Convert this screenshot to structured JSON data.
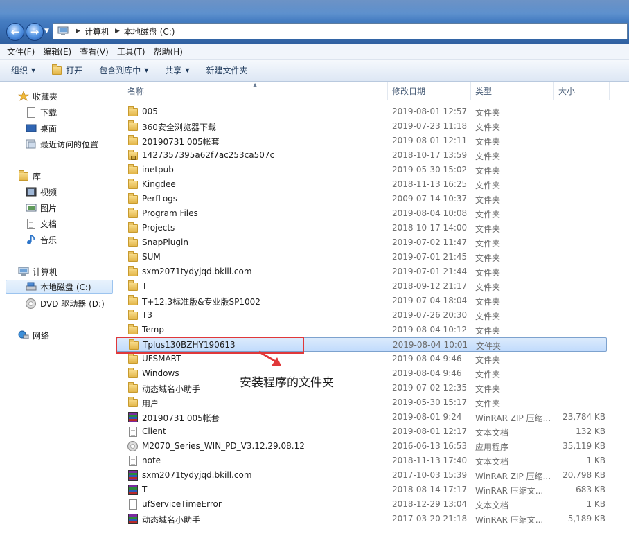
{
  "address": {
    "crumbs": [
      "计算机",
      "本地磁盘 (C:)"
    ]
  },
  "menu": [
    "文件(F)",
    "编辑(E)",
    "查看(V)",
    "工具(T)",
    "帮助(H)"
  ],
  "toolbar": {
    "organize": "组织",
    "open": "打开",
    "include": "包含到库中",
    "share": "共享",
    "new_folder": "新建文件夹"
  },
  "nav": {
    "favorites": "收藏夹",
    "downloads": "下载",
    "desktop": "桌面",
    "recent": "最近访问的位置",
    "libraries": "库",
    "videos": "视频",
    "pictures": "图片",
    "documents": "文档",
    "music": "音乐",
    "computer": "计算机",
    "local_disk": "本地磁盘 (C:)",
    "dvd": "DVD 驱动器 (D:)",
    "network": "网络"
  },
  "columns": {
    "name": "名称",
    "date": "修改日期",
    "type": "类型",
    "size": "大小"
  },
  "files": [
    {
      "name": "005",
      "date": "2019-08-01 12:57",
      "type": "文件夹",
      "size": "",
      "icon": "folder"
    },
    {
      "name": "360安全浏览器下载",
      "date": "2019-07-23 11:18",
      "type": "文件夹",
      "size": "",
      "icon": "folder"
    },
    {
      "name": "20190731 005帐套",
      "date": "2019-08-01 12:11",
      "type": "文件夹",
      "size": "",
      "icon": "folder"
    },
    {
      "name": "1427357395a62f7ac253ca507c",
      "date": "2018-10-17 13:59",
      "type": "文件夹",
      "size": "",
      "icon": "locked-folder"
    },
    {
      "name": "inetpub",
      "date": "2019-05-30 15:02",
      "type": "文件夹",
      "size": "",
      "icon": "folder"
    },
    {
      "name": "Kingdee",
      "date": "2018-11-13 16:25",
      "type": "文件夹",
      "size": "",
      "icon": "folder"
    },
    {
      "name": "PerfLogs",
      "date": "2009-07-14 10:37",
      "type": "文件夹",
      "size": "",
      "icon": "folder"
    },
    {
      "name": "Program Files",
      "date": "2019-08-04 10:08",
      "type": "文件夹",
      "size": "",
      "icon": "folder"
    },
    {
      "name": "Projects",
      "date": "2018-10-17 14:00",
      "type": "文件夹",
      "size": "",
      "icon": "folder"
    },
    {
      "name": "SnapPlugin",
      "date": "2019-07-02 11:47",
      "type": "文件夹",
      "size": "",
      "icon": "folder"
    },
    {
      "name": "SUM",
      "date": "2019-07-01 21:45",
      "type": "文件夹",
      "size": "",
      "icon": "folder"
    },
    {
      "name": "sxm2071tydyjqd.bkill.com",
      "date": "2019-07-01 21:44",
      "type": "文件夹",
      "size": "",
      "icon": "folder"
    },
    {
      "name": "T",
      "date": "2018-09-12 21:17",
      "type": "文件夹",
      "size": "",
      "icon": "folder"
    },
    {
      "name": "T+12.3标准版&专业版SP1002",
      "date": "2019-07-04 18:04",
      "type": "文件夹",
      "size": "",
      "icon": "folder"
    },
    {
      "name": "T3",
      "date": "2019-07-26 20:30",
      "type": "文件夹",
      "size": "",
      "icon": "folder"
    },
    {
      "name": "Temp",
      "date": "2019-08-04 10:12",
      "type": "文件夹",
      "size": "",
      "icon": "folder"
    },
    {
      "name": "Tplus130BZHY190613",
      "date": "2019-08-04 10:01",
      "type": "文件夹",
      "size": "",
      "icon": "folder",
      "selected": true
    },
    {
      "name": "UFSMART",
      "date": "2019-08-04 9:46",
      "type": "文件夹",
      "size": "",
      "icon": "folder"
    },
    {
      "name": "Windows",
      "date": "2019-08-04 9:46",
      "type": "文件夹",
      "size": "",
      "icon": "folder"
    },
    {
      "name": "动态域名小助手",
      "date": "2019-07-02 12:35",
      "type": "文件夹",
      "size": "",
      "icon": "folder"
    },
    {
      "name": "用户",
      "date": "2019-05-30 15:17",
      "type": "文件夹",
      "size": "",
      "icon": "folder"
    },
    {
      "name": "20190731 005帐套",
      "date": "2019-08-01 9:24",
      "type": "WinRAR ZIP 压缩...",
      "size": "23,784 KB",
      "icon": "rar"
    },
    {
      "name": "Client",
      "date": "2019-08-01 12:17",
      "type": "文本文档",
      "size": "132 KB",
      "icon": "doc"
    },
    {
      "name": "M2070_Series_WIN_PD_V3.12.29.08.12",
      "date": "2016-06-13 16:53",
      "type": "应用程序",
      "size": "35,119 KB",
      "icon": "disc"
    },
    {
      "name": "note",
      "date": "2018-11-13 17:40",
      "type": "文本文档",
      "size": "1 KB",
      "icon": "doc"
    },
    {
      "name": "sxm2071tydyjqd.bkill.com",
      "date": "2017-10-03 15:39",
      "type": "WinRAR ZIP 压缩...",
      "size": "20,798 KB",
      "icon": "rar"
    },
    {
      "name": "T",
      "date": "2018-08-14 17:17",
      "type": "WinRAR 压缩文...",
      "size": "683 KB",
      "icon": "rar"
    },
    {
      "name": "ufServiceTimeError",
      "date": "2018-12-29 13:04",
      "type": "文本文档",
      "size": "1 KB",
      "icon": "doc"
    },
    {
      "name": "动态域名小助手",
      "date": "2017-03-20 21:18",
      "type": "WinRAR 压缩文...",
      "size": "5,189 KB",
      "icon": "rar"
    }
  ],
  "annotation": {
    "text": "安装程序的文件夹",
    "color": "#e0383a"
  }
}
